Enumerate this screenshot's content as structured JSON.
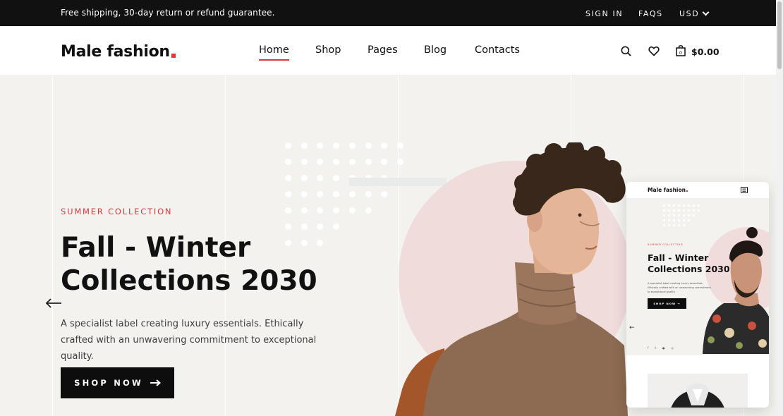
{
  "topbar": {
    "shipping_text": "Free shipping, 30-day return or refund guarantee.",
    "signin": "SIGN IN",
    "faqs": "FAQS",
    "currency": "USD"
  },
  "header": {
    "logo_text": "Male fashion",
    "nav": [
      {
        "label": "Home",
        "active": true
      },
      {
        "label": "Shop",
        "active": false
      },
      {
        "label": "Pages",
        "active": false
      },
      {
        "label": "Blog",
        "active": false
      },
      {
        "label": "Contacts",
        "active": false
      }
    ],
    "cart_total": "$0.00",
    "cart_count": "0",
    "icons": [
      "search-icon",
      "heart-icon",
      "shopping-bag-icon"
    ]
  },
  "hero": {
    "tag": "SUMMER COLLECTION",
    "title_line1": "Fall - Winter",
    "title_line2": "Collections 2030",
    "description": "A specialist label creating luxury essentials. Ethically crafted with an unwavering commitment to exceptional quality.",
    "cta_label": "SHOP NOW",
    "accent_color": "#e53637"
  },
  "mobile_preview": {
    "logo_text": "Male fashion",
    "tag": "SUMMER COLLECTION",
    "title_line1": "Fall - Winter",
    "title_line2": "Collections 2030",
    "description": "A specialist label creating luxury essentials. Ethically crafted with an unwavering commitment to exceptional quality.",
    "cta_label": "SHOP NOW",
    "social_icons": [
      "facebook-icon",
      "twitter-icon",
      "pinterest-icon",
      "instagram-icon"
    ]
  }
}
